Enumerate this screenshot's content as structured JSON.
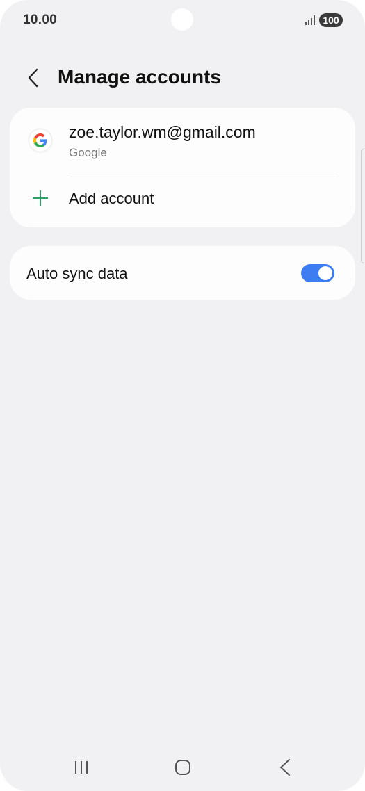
{
  "status_bar": {
    "time": "10.00",
    "battery": "100",
    "signal_icon": "signal-icon"
  },
  "header": {
    "title": "Manage accounts",
    "back_icon": "chevron-left-icon"
  },
  "accounts": [
    {
      "email": "zoe.taylor.wm@gmail.com",
      "type": "Google",
      "icon": "google-icon"
    }
  ],
  "add_account": {
    "label": "Add account",
    "icon": "plus-icon"
  },
  "auto_sync": {
    "label": "Auto sync data",
    "enabled": true
  },
  "nav_bar": {
    "recents_icon": "recents-icon",
    "home_icon": "home-icon",
    "back_icon": "back-icon"
  },
  "colors": {
    "background": "#f1f1f3",
    "card": "#fdfdfd",
    "toggle_on": "#3e7df1",
    "plus": "#2e9e63"
  }
}
